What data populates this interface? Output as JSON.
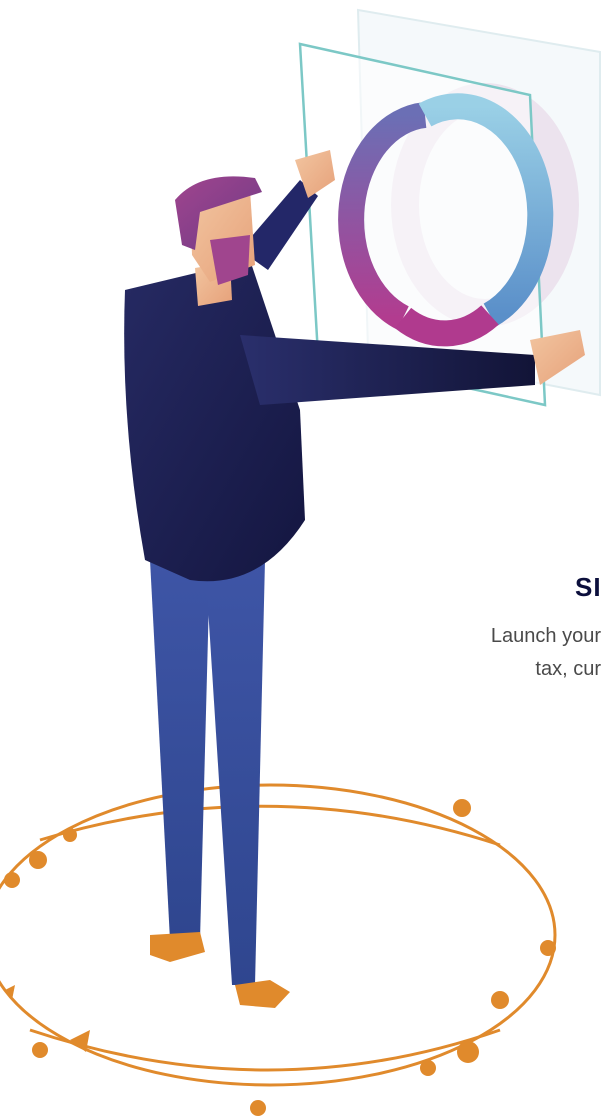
{
  "hero": {
    "headline": "SIMI",
    "subtext_line1": "Launch your",
    "subtext_line2": "tax, cur"
  },
  "colors": {
    "accent_orange": "#e08a2c",
    "navy": "#1f2458",
    "headline_text": "#0c0f3c",
    "body_text": "#4a4a4a",
    "frame_teal": "#7cc8c6"
  },
  "illustration": {
    "subject": "person-adjusting-donut-chart-screen",
    "icons": [
      "donut-chart-icon",
      "orbit-ring-icon"
    ]
  }
}
